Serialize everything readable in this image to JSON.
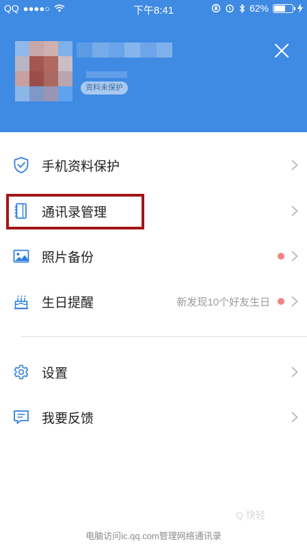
{
  "status_bar": {
    "carrier": "QQ",
    "signal": "●●●●○",
    "time": "下午8:41",
    "battery": "62%",
    "battery_level": 0.62
  },
  "profile": {
    "protection_badge": "资料未保护",
    "close_icon": "close-icon"
  },
  "menu": {
    "items": [
      {
        "icon": "shield-check-icon",
        "label": "手机资料保护",
        "hint": "",
        "dot": false
      },
      {
        "icon": "contacts-book-icon",
        "label": "通讯录管理",
        "hint": "",
        "dot": false
      },
      {
        "icon": "photo-icon",
        "label": "照片备份",
        "hint": "",
        "dot": true
      },
      {
        "icon": "birthday-cake-icon",
        "label": "生日提醒",
        "hint": "新发现10个好友生日",
        "dot": true
      },
      {
        "icon": "gear-icon",
        "label": "设置",
        "hint": "",
        "dot": false
      },
      {
        "icon": "feedback-icon",
        "label": "我要反馈",
        "hint": "",
        "dot": false
      }
    ]
  },
  "footer": {
    "text": "电脑访问ic.qq.com管理网络通讯录"
  },
  "watermark": {
    "text": "Q 快轻"
  },
  "colors": {
    "header_bg": "#3f8ae3",
    "icon_blue": "#2f7fde",
    "highlight_border": "#a31515",
    "red_dot": "#f28383"
  }
}
